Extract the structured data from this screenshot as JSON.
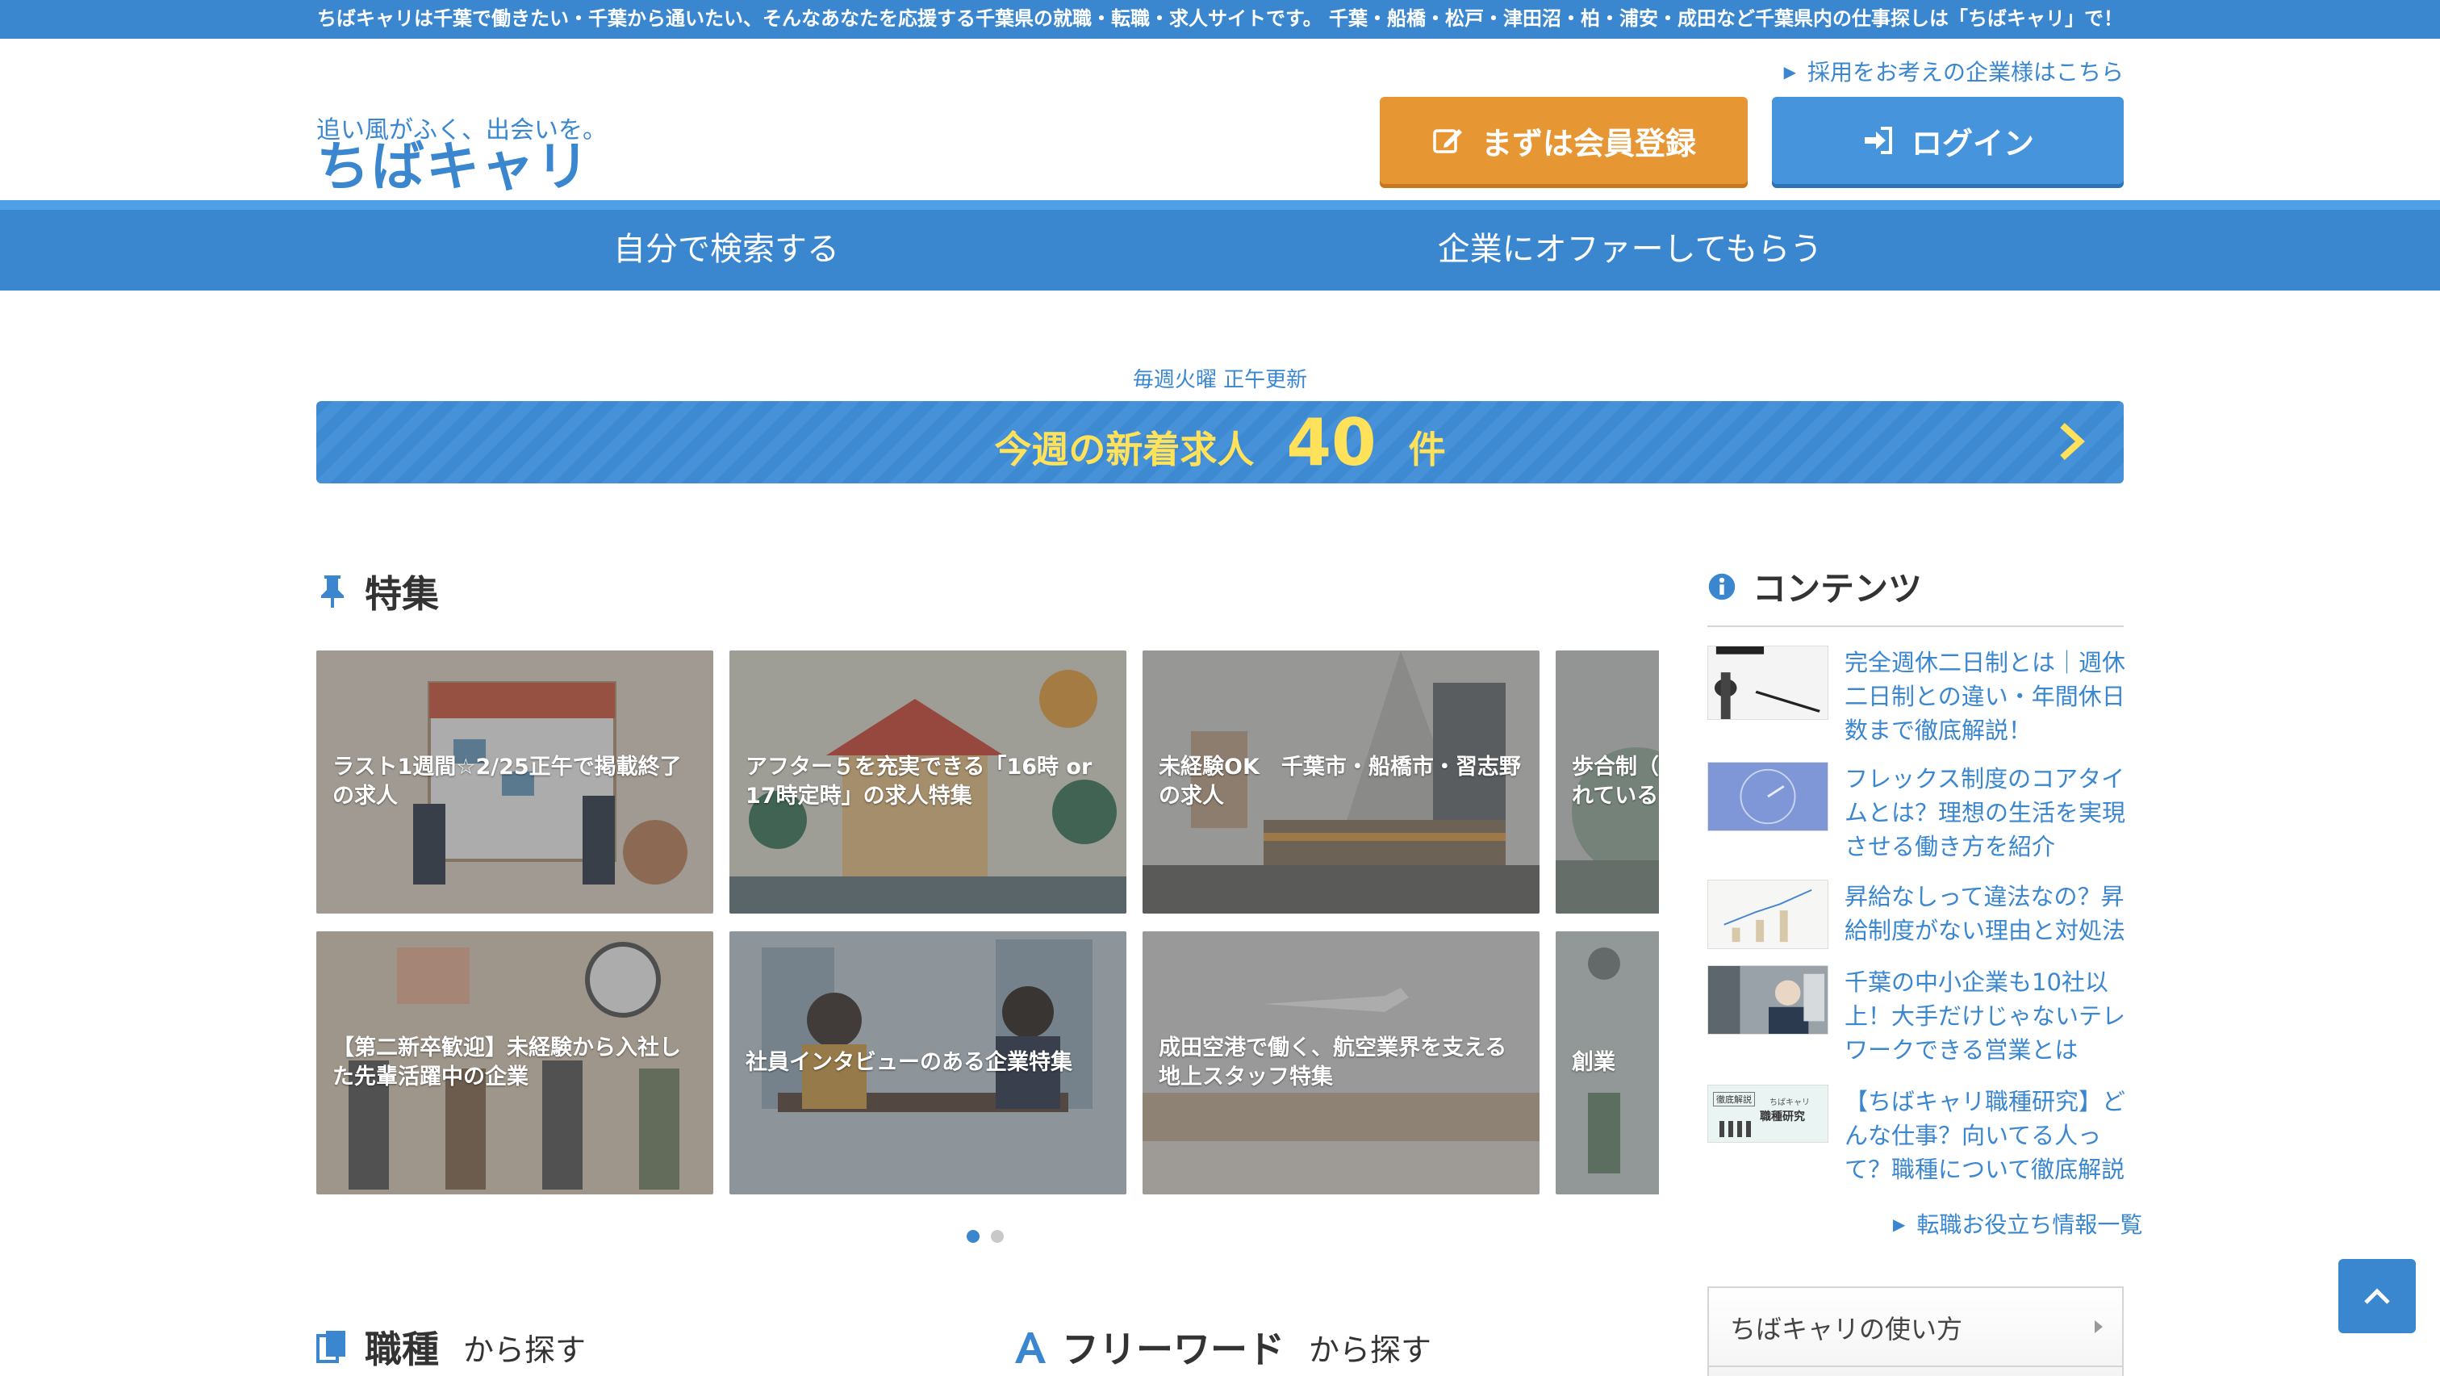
{
  "topbar": {
    "text": "ちばキャリは千葉で働きたい・千葉から通いたい、そんなあなたを応援する千葉県の就職・転職・求人サイトです。 千葉・船橋・松戸・津田沼・柏・浦安・成田など千葉県内の仕事探しは「ちばキャリ」で！"
  },
  "header": {
    "logo_tagline": "追い風がふく、出会いを。",
    "logo_text": "ちばキャリ",
    "corp_link": "採用をお考えの企業様はこちら",
    "register_label": "まずは会員登録",
    "login_label": "ログイン"
  },
  "nav": {
    "search_self": "自分で検索する",
    "get_offer": "企業にオファーしてもらう"
  },
  "new_jobs": {
    "note": "毎週火曜 正午更新",
    "prefix": "今週の新着求人",
    "count": "40",
    "unit": "件"
  },
  "features": {
    "title": "特集",
    "cards": [
      {
        "caption": "ラスト1週間☆2/25正午で掲載終了の求人"
      },
      {
        "caption": "アフター５を充実できる「16時 or 17時定時」の求人特集"
      },
      {
        "caption": "未経験OK　千葉市・船橋市・習志野の求人"
      },
      {
        "caption": "歩合制（インセンティブ）が採用されている"
      },
      {
        "caption": "【第二新卒歓迎】未経験から入社した先輩活躍中の企業"
      },
      {
        "caption": "社員インタビューのある企業特集"
      },
      {
        "caption": "成田空港で働く、航空業界を支える地上スタッフ特集"
      },
      {
        "caption": "創業"
      }
    ]
  },
  "contents": {
    "title": "コンテンツ",
    "items": [
      {
        "title": "完全週休二日制とは｜週休二日制との違い・年間休日数まで徹底解説！"
      },
      {
        "title": "フレックス制度のコアタイムとは？理想の生活を実現させる働き方を紹介"
      },
      {
        "title": "昇給なしって違法なの？昇給制度がない理由と対処法"
      },
      {
        "title": "千葉の中小企業も10社以上！大手だけじゃないテレワークできる営業とは"
      },
      {
        "title": "【ちばキャリ職種研究】どんな仕事？向いてる人って？職種について徹底解説"
      }
    ],
    "more_link": "転職お役立ち情報一覧",
    "thumb5_badge": "徹底解説",
    "thumb5_brand": "ちばキャリ",
    "thumb5_title": "職種研究"
  },
  "guide": {
    "label": "ちばキャリの使い方"
  },
  "search_by": {
    "job_type_title": "職種",
    "job_type_sub": "から探す",
    "freeword_title": "フリーワード",
    "freeword_sub": "から探す"
  },
  "colors": {
    "primary": "#3a87d0",
    "accent": "#e79634",
    "highlight": "#ffe25a"
  }
}
